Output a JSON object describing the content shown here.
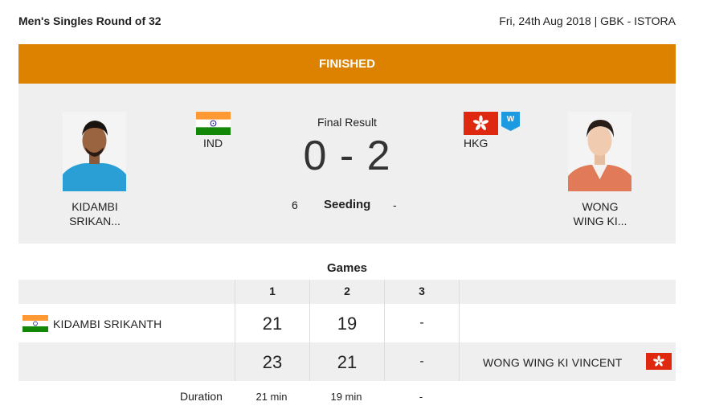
{
  "header": {
    "event": "Men's Singles Round of 32",
    "meta": "Fri, 24th Aug 2018 | GBK - ISTORA"
  },
  "status": "FINISHED",
  "match": {
    "final_label": "Final Result",
    "score": "0 - 2",
    "seeding_label": "Seeding",
    "left": {
      "name_line1": "KIDAMBI",
      "name_line2": "SRIKAN...",
      "country": "IND",
      "seed": "6",
      "flag_icon": "india-flag-icon"
    },
    "right": {
      "name_line1": "WONG",
      "name_line2": "WING KI...",
      "country": "HKG",
      "seed": "-",
      "flag_icon": "hong-kong-flag-icon",
      "badge": "W"
    }
  },
  "games": {
    "title": "Games",
    "columns": [
      "1",
      "2",
      "3"
    ],
    "rows": [
      {
        "player": "KIDAMBI  SRIKANTH",
        "scores": [
          "21",
          "19",
          "-"
        ]
      },
      {
        "player": "WONG  WING KI VINCENT",
        "scores": [
          "23",
          "21",
          "-"
        ]
      }
    ],
    "duration_label": "Duration",
    "durations": [
      "21 min",
      "19 min",
      "-"
    ]
  },
  "colors": {
    "status_orange": "#dc8200",
    "panel_grey": "#efefef",
    "hk_red": "#de2910",
    "badge_blue": "#1e9be0"
  }
}
